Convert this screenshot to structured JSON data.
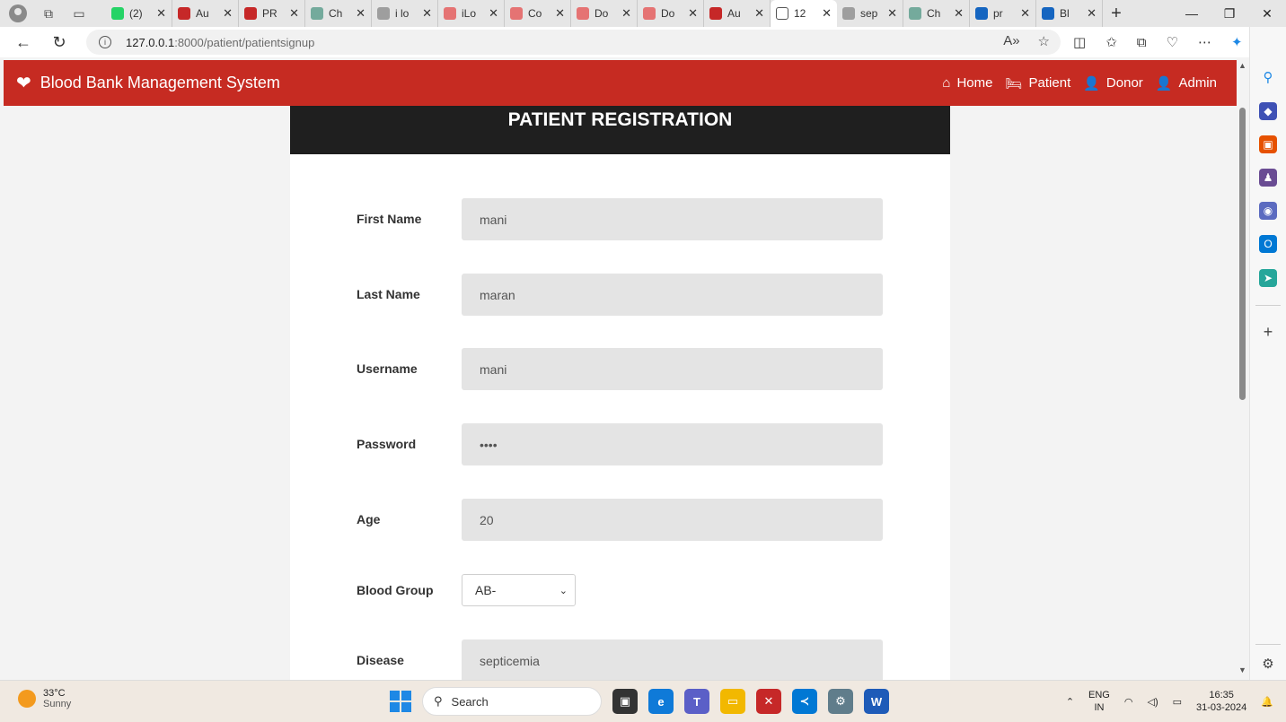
{
  "browser": {
    "tabs": [
      {
        "title": "(2)",
        "favicon": "whatsapp-icon",
        "color": "#25d366"
      },
      {
        "title": "Au",
        "favicon": "pdf-icon",
        "color": "#c62828"
      },
      {
        "title": "PR",
        "favicon": "pdf-icon",
        "color": "#c62828"
      },
      {
        "title": "Ch",
        "favicon": "chatgpt-icon",
        "color": "#74aa9c"
      },
      {
        "title": "i lo",
        "favicon": "search-icon",
        "color": "#9e9e9e"
      },
      {
        "title": "iLo",
        "favicon": "heart-icon",
        "color": "#e57373"
      },
      {
        "title": "Co",
        "favicon": "heart-icon",
        "color": "#e57373"
      },
      {
        "title": "Do",
        "favicon": "heart-icon",
        "color": "#e57373"
      },
      {
        "title": "Do",
        "favicon": "heart-icon",
        "color": "#e57373"
      },
      {
        "title": "Au",
        "favicon": "pdf-icon",
        "color": "#c62828"
      },
      {
        "title": "12",
        "favicon": "page-icon",
        "color": "#ffffff",
        "active": true
      },
      {
        "title": "sep",
        "favicon": "search-icon",
        "color": "#9e9e9e"
      },
      {
        "title": "Ch",
        "favicon": "chatgpt-icon",
        "color": "#74aa9c"
      },
      {
        "title": "pr",
        "favicon": "search-icon",
        "color": "#1565c0"
      },
      {
        "title": "Bl",
        "favicon": "search-icon",
        "color": "#1565c0"
      }
    ],
    "url_host": "127.0.0.1",
    "url_path": ":8000/patient/patientsignup"
  },
  "navbar": {
    "brand": "Blood Bank Management System",
    "links": [
      {
        "label": "Home",
        "icon": "home-icon"
      },
      {
        "label": "Patient",
        "icon": "bed-icon"
      },
      {
        "label": "Donor",
        "icon": "user-icon"
      },
      {
        "label": "Admin",
        "icon": "user-gear-icon"
      }
    ],
    "color": "#c62b22"
  },
  "form": {
    "title": "PATIENT REGISTRATION",
    "first_name": {
      "label": "First Name",
      "value": "mani"
    },
    "last_name": {
      "label": "Last Name",
      "value": "maran"
    },
    "username": {
      "label": "Username",
      "value": "mani"
    },
    "password": {
      "label": "Password",
      "value": "••••"
    },
    "age": {
      "label": "Age",
      "value": "20"
    },
    "blood_group": {
      "label": "Blood Group",
      "value": "AB-"
    },
    "disease": {
      "label": "Disease",
      "value": "septicemia"
    }
  },
  "taskbar": {
    "weather_temp": "33°C",
    "weather_desc": "Sunny",
    "search_label": "Search",
    "lang_top": "ENG",
    "lang_bottom": "IN",
    "time": "16:35",
    "date": "31-03-2024"
  }
}
